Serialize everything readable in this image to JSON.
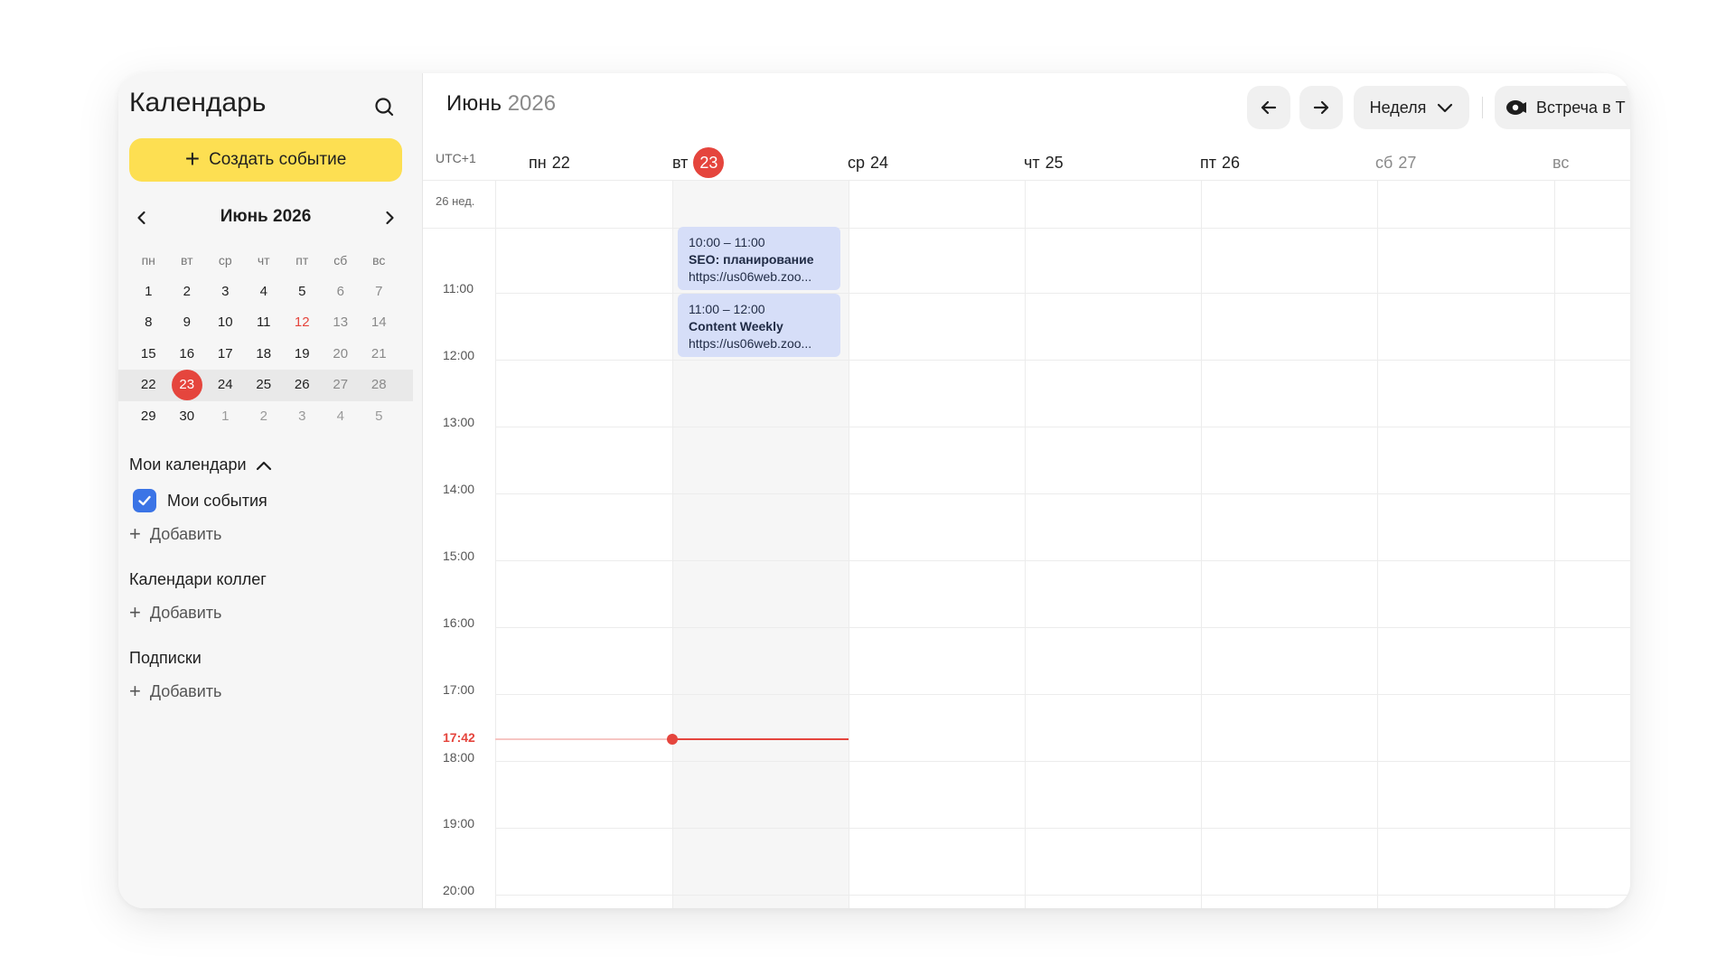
{
  "sidebar": {
    "title": "Календарь",
    "create_label": "Создать событие",
    "mini_calendar": {
      "title": "Июнь 2026",
      "weekdays": [
        "пн",
        "вт",
        "ср",
        "чт",
        "пт",
        "сб",
        "вс"
      ],
      "weeks": [
        [
          "1",
          "2",
          "3",
          "4",
          "5",
          "6",
          "7"
        ],
        [
          "8",
          "9",
          "10",
          "11",
          "12",
          "13",
          "14"
        ],
        [
          "15",
          "16",
          "17",
          "18",
          "19",
          "20",
          "21"
        ],
        [
          "22",
          "23",
          "24",
          "25",
          "26",
          "27",
          "28"
        ],
        [
          "29",
          "30",
          "1",
          "2",
          "3",
          "4",
          "5"
        ]
      ],
      "today": "23",
      "holiday": "12"
    },
    "my_calendars": {
      "title": "Мои календари",
      "items": [
        {
          "label": "Мои события",
          "checked": true,
          "color": "#3b74e6"
        }
      ],
      "add_label": "Добавить"
    },
    "colleagues": {
      "title": "Календари коллег",
      "add_label": "Добавить"
    },
    "subscriptions": {
      "title": "Подписки",
      "add_label": "Добавить"
    }
  },
  "main": {
    "month": "Июнь",
    "year": "2026",
    "view_label": "Неделя",
    "meet_label": "Встреча в Т",
    "timezone": "UTC+1",
    "week_label": "26 нед.",
    "days": [
      {
        "wd": "пн",
        "num": "22"
      },
      {
        "wd": "вт",
        "num": "23"
      },
      {
        "wd": "ср",
        "num": "24"
      },
      {
        "wd": "чт",
        "num": "25"
      },
      {
        "wd": "пт",
        "num": "26"
      },
      {
        "wd": "сб",
        "num": "27"
      },
      {
        "wd": "вс",
        "num": ""
      }
    ],
    "hours": [
      "11:00",
      "12:00",
      "13:00",
      "14:00",
      "15:00",
      "16:00",
      "17:00",
      "18:00",
      "19:00",
      "20:00"
    ],
    "now": "17:42",
    "events": [
      {
        "time": "10:00 – 11:00",
        "title": "SEO: планирование",
        "link": "https://us06web.zoo..."
      },
      {
        "time": "11:00 – 12:00",
        "title": "Content Weekly",
        "link": "https://us06web.zoo..."
      }
    ],
    "colors": {
      "accent": "#fddf52",
      "today": "#e5453d",
      "event_bg": "#d6def8",
      "checkbox": "#3b74e6"
    }
  }
}
